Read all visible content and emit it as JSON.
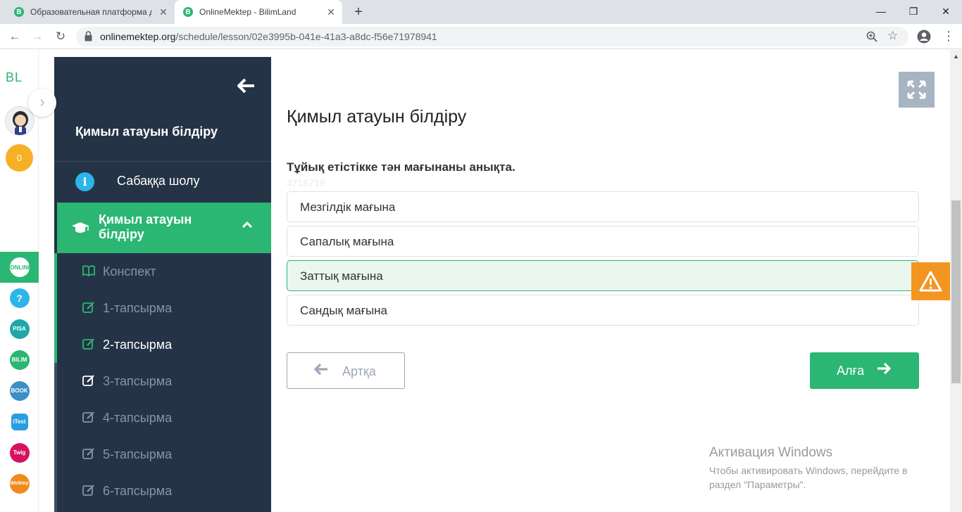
{
  "browser": {
    "tabs": [
      {
        "label": "Образовательная платформа дл",
        "favicon": "B"
      },
      {
        "label": "OnlineMektep - BilimLand",
        "favicon": "B"
      }
    ],
    "new_tab": "+",
    "window_controls": {
      "minimize": "—",
      "restore": "❐",
      "close": "✕"
    },
    "url_host": "onlinemektep.org",
    "url_path": "/schedule/lesson/02e3995b-041e-41a3-a8dc-f56e71978941"
  },
  "leftrail": {
    "logo": "BL",
    "coins": "0",
    "apps": [
      {
        "name": "onlinemektep",
        "text": "ONLINE",
        "color": "#2bb673"
      },
      {
        "name": "help",
        "text": "?",
        "color": "#2cb5e8"
      },
      {
        "name": "pisa",
        "text": "PISA",
        "color": "#1fa7a8"
      },
      {
        "name": "bilimland",
        "text": "BILIM",
        "color": "#2bb673"
      },
      {
        "name": "bilimbook",
        "text": "BOOK",
        "color": "#3a8fc5"
      },
      {
        "name": "itest",
        "text": "iTest",
        "color": "#2a9de0"
      },
      {
        "name": "twig",
        "text": "Twig",
        "color": "#d7125f"
      },
      {
        "name": "imektep",
        "text": "iMektep",
        "color": "#f08a1c"
      }
    ]
  },
  "sidebar": {
    "lesson_title": "Қимыл атауын білдіру",
    "overview": "Сабаққа шолу",
    "section_title": "Қимыл атауын білдіру",
    "items": [
      {
        "label": "Конспект",
        "icon": "book-icon",
        "state": "done"
      },
      {
        "label": "1-тапсырма",
        "icon": "edit-icon",
        "state": "done"
      },
      {
        "label": "2-тапсырма",
        "icon": "edit-icon",
        "state": "active"
      },
      {
        "label": "3-тапсырма",
        "icon": "edit-icon",
        "state": "todo"
      },
      {
        "label": "4-тапсырма",
        "icon": "edit-icon",
        "state": "todo"
      },
      {
        "label": "5-тапсырма",
        "icon": "edit-icon",
        "state": "todo"
      },
      {
        "label": "6-тапсырма",
        "icon": "edit-icon",
        "state": "todo"
      }
    ]
  },
  "main": {
    "title": "Қимыл атауын білдіру",
    "question": "Тұйық етістікке тән мағынаны анықта.",
    "question_id": "4716719",
    "options": [
      {
        "text": "Мезгілдік мағына",
        "selected": false
      },
      {
        "text": "Сапалық мағына",
        "selected": false
      },
      {
        "text": "Заттық мағына",
        "selected": true
      },
      {
        "text": "Сандық мағына",
        "selected": false
      }
    ],
    "back_label": "Артқа",
    "next_label": "Алға"
  },
  "windows_activation": {
    "heading": "Активация Windows",
    "text": "Чтобы активировать Windows, перейдите в раздел \"Параметры\"."
  },
  "colors": {
    "accent": "#2bb673",
    "sidebar_bg": "#253346",
    "warning": "#f39521"
  }
}
